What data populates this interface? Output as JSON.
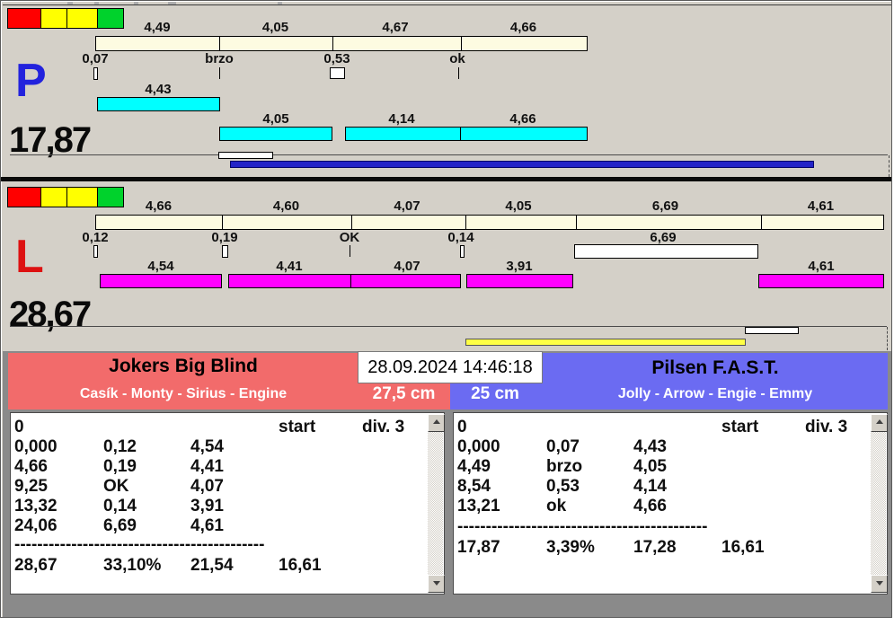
{
  "colors": {
    "window_bg": "#D4D0C8",
    "section_bg": "#8A8A8A",
    "light_red": "#FF0000",
    "light_yellow": "#FFFF00",
    "light_green": "#00D22C",
    "split_bar": "#FDFBE1",
    "p_dog_bar": "#00FFFF",
    "l_dog_bar": "#FF00FF",
    "p_lane_letter": "#2222DD",
    "l_lane_letter": "#DD1111",
    "p_progress": "#2323C8",
    "l_progress": "#FFFF44",
    "left_team_header": "#F26B6B",
    "right_team_header": "#6B6BF2"
  },
  "p_panel": {
    "lane": "P",
    "total": "17,87",
    "split_labels": [
      "4,49",
      "4,05",
      "4,67",
      "4,66"
    ],
    "penalty_labels": [
      "0,07",
      "brzo",
      "0,53",
      "ok"
    ],
    "dog_time_first": "4,43",
    "dog_time_labels": [
      "4,05",
      "4,14",
      "4,66"
    ]
  },
  "l_panel": {
    "lane": "L",
    "total": "28,67",
    "split_labels": [
      "4,66",
      "4,60",
      "4,07",
      "4,05",
      "6,69",
      "4,61"
    ],
    "penalty_labels": [
      "0,12",
      "0,19",
      "OK",
      "0,14"
    ],
    "white_bar_label": "6,69",
    "dog_time_labels": [
      "4,54",
      "4,41",
      "4,07",
      "3,91",
      "4,61"
    ]
  },
  "scoreboard": {
    "datetime": "28.09.2024 14:46:18",
    "left": {
      "team": "Jokers Big Blind",
      "dogs": "Casík - Monty - Sirius - Engine",
      "category": "27,5 cm",
      "table": {
        "zero": "0",
        "start": "start",
        "division": "div. 3",
        "rows": [
          [
            "0,000",
            "0,12",
            "4,54"
          ],
          [
            "4,66",
            "0,19",
            "4,41"
          ],
          [
            "9,25",
            "OK",
            "4,07"
          ],
          [
            "13,32",
            "0,14",
            "3,91"
          ],
          [
            "24,06",
            "6,69",
            "4,61"
          ]
        ],
        "separator": "--------------------------------------------",
        "total": [
          "28,67",
          "33,10%",
          "21,54",
          "16,61"
        ]
      }
    },
    "right": {
      "team": "Pilsen F.A.S.T.",
      "dogs": "Jolly - Arrow - Engie - Emmy",
      "category": "25 cm",
      "table": {
        "zero": "0",
        "start": "start",
        "division": "div. 3",
        "rows": [
          [
            "0,000",
            "0,07",
            "4,43"
          ],
          [
            "4,49",
            "brzo",
            "4,05"
          ],
          [
            "8,54",
            "0,53",
            "4,14"
          ],
          [
            "13,21",
            "ok",
            "4,66"
          ]
        ],
        "separator": "--------------------------------------------",
        "total": [
          "17,87",
          "3,39%",
          "17,28",
          "16,61"
        ]
      }
    }
  }
}
